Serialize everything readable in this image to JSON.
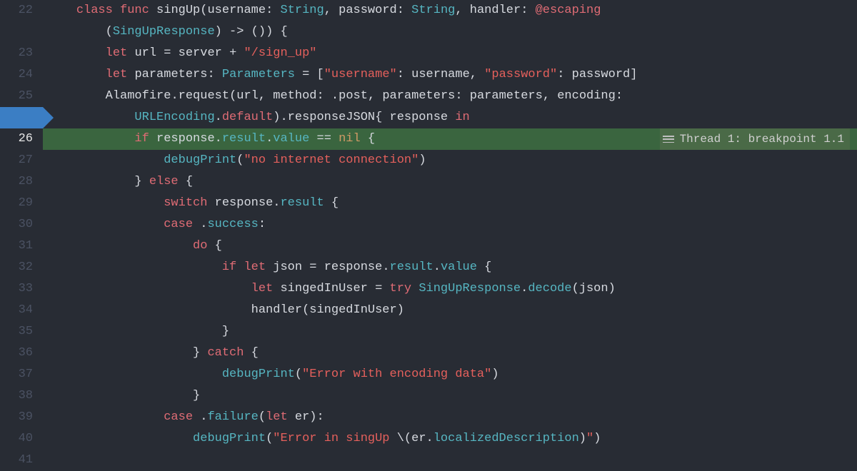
{
  "debugger": {
    "thread_label": "Thread 1: breakpoint 1.1"
  },
  "gutter": {
    "start": 22,
    "end": 41
  },
  "lines": [
    {
      "n": 22,
      "tokens": [
        {
          "t": "    ",
          "c": ""
        },
        {
          "t": "class",
          "c": "kw"
        },
        {
          "t": " ",
          "c": ""
        },
        {
          "t": "func",
          "c": "kw"
        },
        {
          "t": " ",
          "c": ""
        },
        {
          "t": "singUp",
          "c": "id"
        },
        {
          "t": "(",
          "c": "id"
        },
        {
          "t": "username",
          "c": "id"
        },
        {
          "t": ": ",
          "c": "id"
        },
        {
          "t": "String",
          "c": "type"
        },
        {
          "t": ", ",
          "c": "id"
        },
        {
          "t": "password",
          "c": "id"
        },
        {
          "t": ": ",
          "c": "id"
        },
        {
          "t": "String",
          "c": "type"
        },
        {
          "t": ", ",
          "c": "id"
        },
        {
          "t": "handler",
          "c": "id"
        },
        {
          "t": ": ",
          "c": "id"
        },
        {
          "t": "@escaping",
          "c": "kw"
        }
      ]
    },
    {
      "n": 22,
      "wrap": true,
      "tokens": [
        {
          "t": "        (",
          "c": "id"
        },
        {
          "t": "SingUpResponse",
          "c": "type"
        },
        {
          "t": ") -> ()) {",
          "c": "id"
        }
      ]
    },
    {
      "n": 23,
      "tokens": [
        {
          "t": "        ",
          "c": ""
        },
        {
          "t": "let",
          "c": "kw"
        },
        {
          "t": " ",
          "c": ""
        },
        {
          "t": "url",
          "c": "id"
        },
        {
          "t": " = ",
          "c": "id"
        },
        {
          "t": "server",
          "c": "id"
        },
        {
          "t": " + ",
          "c": "id"
        },
        {
          "t": "\"/sign_up\"",
          "c": "str"
        }
      ]
    },
    {
      "n": 24,
      "tokens": [
        {
          "t": "        ",
          "c": ""
        },
        {
          "t": "let",
          "c": "kw"
        },
        {
          "t": " ",
          "c": ""
        },
        {
          "t": "parameters",
          "c": "id"
        },
        {
          "t": ": ",
          "c": "id"
        },
        {
          "t": "Parameters",
          "c": "type"
        },
        {
          "t": " = [",
          "c": "id"
        },
        {
          "t": "\"username\"",
          "c": "str"
        },
        {
          "t": ": ",
          "c": "id"
        },
        {
          "t": "username",
          "c": "id"
        },
        {
          "t": ", ",
          "c": "id"
        },
        {
          "t": "\"password\"",
          "c": "str"
        },
        {
          "t": ": ",
          "c": "id"
        },
        {
          "t": "password",
          "c": "id"
        },
        {
          "t": "]",
          "c": "id"
        }
      ]
    },
    {
      "n": 25,
      "tokens": [
        {
          "t": "        ",
          "c": ""
        },
        {
          "t": "Alamofire",
          "c": "id"
        },
        {
          "t": ".",
          "c": "id"
        },
        {
          "t": "request",
          "c": "id"
        },
        {
          "t": "(",
          "c": "id"
        },
        {
          "t": "url",
          "c": "id"
        },
        {
          "t": ", ",
          "c": "id"
        },
        {
          "t": "method",
          "c": "id"
        },
        {
          "t": ": .",
          "c": "id"
        },
        {
          "t": "post",
          "c": "id"
        },
        {
          "t": ", ",
          "c": "id"
        },
        {
          "t": "parameters",
          "c": "id"
        },
        {
          "t": ": ",
          "c": "id"
        },
        {
          "t": "parameters",
          "c": "id"
        },
        {
          "t": ", ",
          "c": "id"
        },
        {
          "t": "encoding",
          "c": "id"
        },
        {
          "t": ":",
          "c": "id"
        }
      ]
    },
    {
      "n": 25,
      "wrap": true,
      "tokens": [
        {
          "t": "            ",
          "c": ""
        },
        {
          "t": "URLEncoding",
          "c": "type"
        },
        {
          "t": ".",
          "c": "id"
        },
        {
          "t": "default",
          "c": "kw"
        },
        {
          "t": ").",
          "c": "id"
        },
        {
          "t": "responseJSON",
          "c": "id"
        },
        {
          "t": "{ ",
          "c": "id"
        },
        {
          "t": "response",
          "c": "id"
        },
        {
          "t": " ",
          "c": ""
        },
        {
          "t": "in",
          "c": "kw"
        }
      ]
    },
    {
      "n": 26,
      "highlight": true,
      "tokens": [
        {
          "t": "            ",
          "c": ""
        },
        {
          "t": "if",
          "c": "kw"
        },
        {
          "t": " ",
          "c": ""
        },
        {
          "t": "response",
          "c": "id"
        },
        {
          "t": ".",
          "c": "id"
        },
        {
          "t": "result",
          "c": "prop"
        },
        {
          "t": ".",
          "c": "id"
        },
        {
          "t": "value",
          "c": "prop"
        },
        {
          "t": " == ",
          "c": "id"
        },
        {
          "t": "nil",
          "c": "nil"
        },
        {
          "t": " {",
          "c": "id"
        }
      ]
    },
    {
      "n": 27,
      "tokens": [
        {
          "t": "                ",
          "c": ""
        },
        {
          "t": "debugPrint",
          "c": "type"
        },
        {
          "t": "(",
          "c": "id"
        },
        {
          "t": "\"no internet connection\"",
          "c": "str"
        },
        {
          "t": ")",
          "c": "id"
        }
      ]
    },
    {
      "n": 28,
      "tokens": [
        {
          "t": "            } ",
          "c": "id"
        },
        {
          "t": "else",
          "c": "kw"
        },
        {
          "t": " {",
          "c": "id"
        }
      ]
    },
    {
      "n": 29,
      "tokens": [
        {
          "t": "                ",
          "c": ""
        },
        {
          "t": "switch",
          "c": "kw"
        },
        {
          "t": " ",
          "c": ""
        },
        {
          "t": "response",
          "c": "id"
        },
        {
          "t": ".",
          "c": "id"
        },
        {
          "t": "result",
          "c": "prop"
        },
        {
          "t": " {",
          "c": "id"
        }
      ]
    },
    {
      "n": 30,
      "tokens": [
        {
          "t": "                ",
          "c": ""
        },
        {
          "t": "case",
          "c": "kw"
        },
        {
          "t": " .",
          "c": "id"
        },
        {
          "t": "success",
          "c": "prop"
        },
        {
          "t": ":",
          "c": "id"
        }
      ]
    },
    {
      "n": 31,
      "tokens": [
        {
          "t": "                    ",
          "c": ""
        },
        {
          "t": "do",
          "c": "kw"
        },
        {
          "t": " {",
          "c": "id"
        }
      ]
    },
    {
      "n": 32,
      "tokens": [
        {
          "t": "                        ",
          "c": ""
        },
        {
          "t": "if",
          "c": "kw"
        },
        {
          "t": " ",
          "c": ""
        },
        {
          "t": "let",
          "c": "kw"
        },
        {
          "t": " ",
          "c": ""
        },
        {
          "t": "json",
          "c": "id"
        },
        {
          "t": " = ",
          "c": "id"
        },
        {
          "t": "response",
          "c": "id"
        },
        {
          "t": ".",
          "c": "id"
        },
        {
          "t": "result",
          "c": "prop"
        },
        {
          "t": ".",
          "c": "id"
        },
        {
          "t": "value",
          "c": "prop"
        },
        {
          "t": " {",
          "c": "id"
        }
      ]
    },
    {
      "n": 33,
      "tokens": [
        {
          "t": "                            ",
          "c": ""
        },
        {
          "t": "let",
          "c": "kw"
        },
        {
          "t": " ",
          "c": ""
        },
        {
          "t": "singedInUser",
          "c": "id"
        },
        {
          "t": " = ",
          "c": "id"
        },
        {
          "t": "try",
          "c": "kw"
        },
        {
          "t": " ",
          "c": ""
        },
        {
          "t": "SingUpResponse",
          "c": "type"
        },
        {
          "t": ".",
          "c": "id"
        },
        {
          "t": "decode",
          "c": "prop"
        },
        {
          "t": "(",
          "c": "id"
        },
        {
          "t": "json",
          "c": "id"
        },
        {
          "t": ")",
          "c": "id"
        }
      ]
    },
    {
      "n": 34,
      "tokens": [
        {
          "t": "                            ",
          "c": ""
        },
        {
          "t": "handler",
          "c": "id"
        },
        {
          "t": "(",
          "c": "id"
        },
        {
          "t": "singedInUser",
          "c": "id"
        },
        {
          "t": ")",
          "c": "id"
        }
      ]
    },
    {
      "n": 35,
      "tokens": [
        {
          "t": "                        }",
          "c": "id"
        }
      ]
    },
    {
      "n": 36,
      "tokens": [
        {
          "t": "                    } ",
          "c": "id"
        },
        {
          "t": "catch",
          "c": "kw"
        },
        {
          "t": " {",
          "c": "id"
        }
      ]
    },
    {
      "n": 37,
      "tokens": [
        {
          "t": "                        ",
          "c": ""
        },
        {
          "t": "debugPrint",
          "c": "type"
        },
        {
          "t": "(",
          "c": "id"
        },
        {
          "t": "\"Error with encoding data\"",
          "c": "str"
        },
        {
          "t": ")",
          "c": "id"
        }
      ]
    },
    {
      "n": 38,
      "tokens": [
        {
          "t": "                    }",
          "c": "id"
        }
      ]
    },
    {
      "n": 39,
      "tokens": [
        {
          "t": "                ",
          "c": ""
        },
        {
          "t": "case",
          "c": "kw"
        },
        {
          "t": " .",
          "c": "id"
        },
        {
          "t": "failure",
          "c": "prop"
        },
        {
          "t": "(",
          "c": "id"
        },
        {
          "t": "let",
          "c": "kw"
        },
        {
          "t": " ",
          "c": ""
        },
        {
          "t": "er",
          "c": "id"
        },
        {
          "t": "):",
          "c": "id"
        }
      ]
    },
    {
      "n": 40,
      "tokens": [
        {
          "t": "                    ",
          "c": ""
        },
        {
          "t": "debugPrint",
          "c": "type"
        },
        {
          "t": "(",
          "c": "id"
        },
        {
          "t": "\"Error in singUp ",
          "c": "str"
        },
        {
          "t": "\\(",
          "c": "id"
        },
        {
          "t": "er",
          "c": "id"
        },
        {
          "t": ".",
          "c": "id"
        },
        {
          "t": "localizedDescription",
          "c": "prop"
        },
        {
          "t": ")",
          "c": "id"
        },
        {
          "t": "\"",
          "c": "str"
        },
        {
          "t": ")",
          "c": "id"
        }
      ]
    },
    {
      "n": 41,
      "tokens": []
    }
  ]
}
